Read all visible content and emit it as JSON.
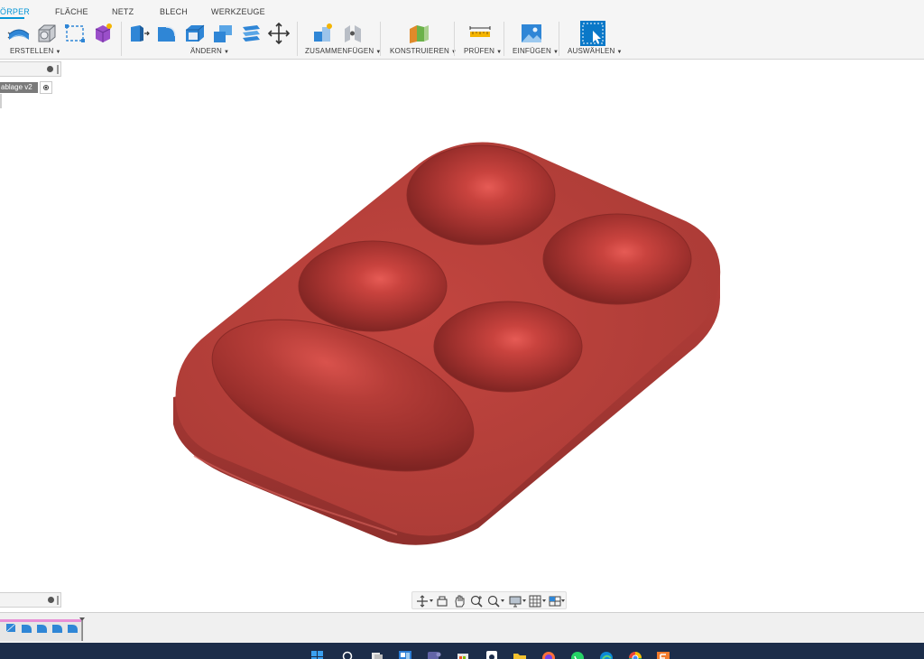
{
  "tabs": [
    {
      "label": "ÖRPER",
      "active": true
    },
    {
      "label": "FLÄCHE",
      "active": false
    },
    {
      "label": "NETZ",
      "active": false
    },
    {
      "label": "BLECH",
      "active": false
    },
    {
      "label": "WERKZEUGE",
      "active": false
    }
  ],
  "toolbar_groups": [
    {
      "label": "ERSTELLEN",
      "icons": [
        "create-form-icon",
        "extrude-icon",
        "sketch-icon",
        "create-base-feature-icon"
      ]
    },
    {
      "label": "ÄNDERN",
      "icons": [
        "press-pull-icon",
        "fillet-icon",
        "shell-icon",
        "combine-icon",
        "offset-face-icon",
        "move-icon"
      ]
    },
    {
      "label": "ZUSAMMENFÜGEN",
      "icons": [
        "new-component-icon",
        "joint-icon"
      ]
    },
    {
      "label": "KONSTRUIEREN",
      "icons": [
        "construct-plane-icon"
      ]
    },
    {
      "label": "PRÜFEN",
      "icons": [
        "measure-icon"
      ]
    },
    {
      "label": "EINFÜGEN",
      "icons": [
        "insert-image-icon"
      ]
    },
    {
      "label": "AUSWÄHLEN",
      "icons": [
        "select-icon"
      ]
    }
  ],
  "browser": {
    "document_name": "ablage v2"
  },
  "navbar": {
    "icons": [
      "orbit-icon",
      "look-at-icon",
      "pan-icon",
      "zoom-icon",
      "fit-icon",
      "display-settings-icon",
      "grid-settings-icon",
      "viewports-icon"
    ]
  },
  "timeline": {
    "items": [
      "sketch-feature-icon",
      "fillet-feature-icon",
      "fillet-feature-icon",
      "fillet-feature-icon",
      "fillet-feature-icon"
    ]
  },
  "taskbar": {
    "icons": [
      "windows-start-icon",
      "search-icon",
      "task-view-icon",
      "widgets-icon",
      "teams-icon",
      "store-icon",
      "tips-icon",
      "file-explorer-icon",
      "firefox-icon",
      "whatsapp-icon",
      "edge-icon",
      "chrome-icon",
      "fusion-icon"
    ]
  },
  "colors": {
    "accent": "#0696d7",
    "model_body": "#b8403b",
    "taskbar": "#1c2d4a"
  }
}
